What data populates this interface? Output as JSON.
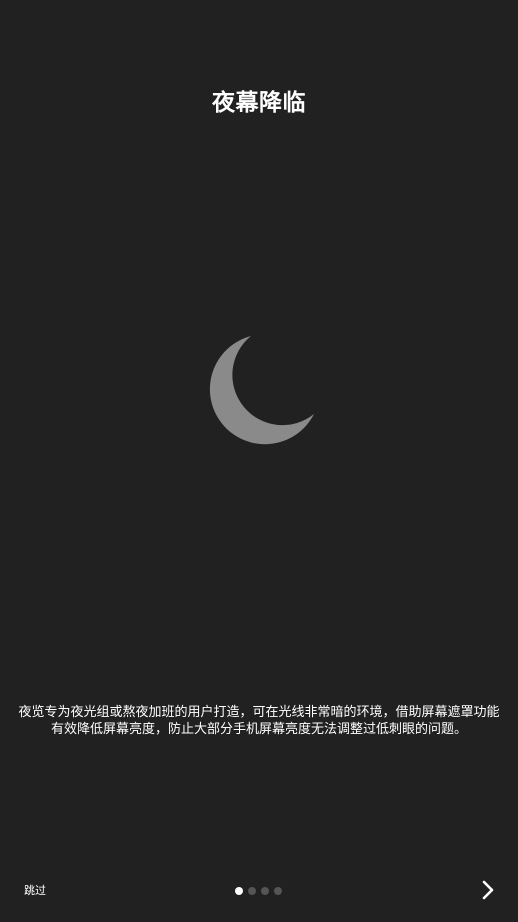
{
  "onboarding": {
    "title": "夜幕降临",
    "description": "夜览专为夜光组或熬夜加班的用户打造，可在光线非常暗的环境，借助屏幕遮罩功能有效降低屏幕亮度，防止大部分手机屏幕亮度无法调整过低刺眼的问题。",
    "illustration_icon": "crescent-moon-icon",
    "skip_label": "跳过",
    "next_icon": "chevron-right-icon",
    "pages_total": 4,
    "current_page": 1
  },
  "colors": {
    "background": "#212121",
    "moon": "#8a8a8a",
    "text": "#ffffff",
    "dot_active": "#ffffff",
    "dot_inactive": "#555555"
  }
}
